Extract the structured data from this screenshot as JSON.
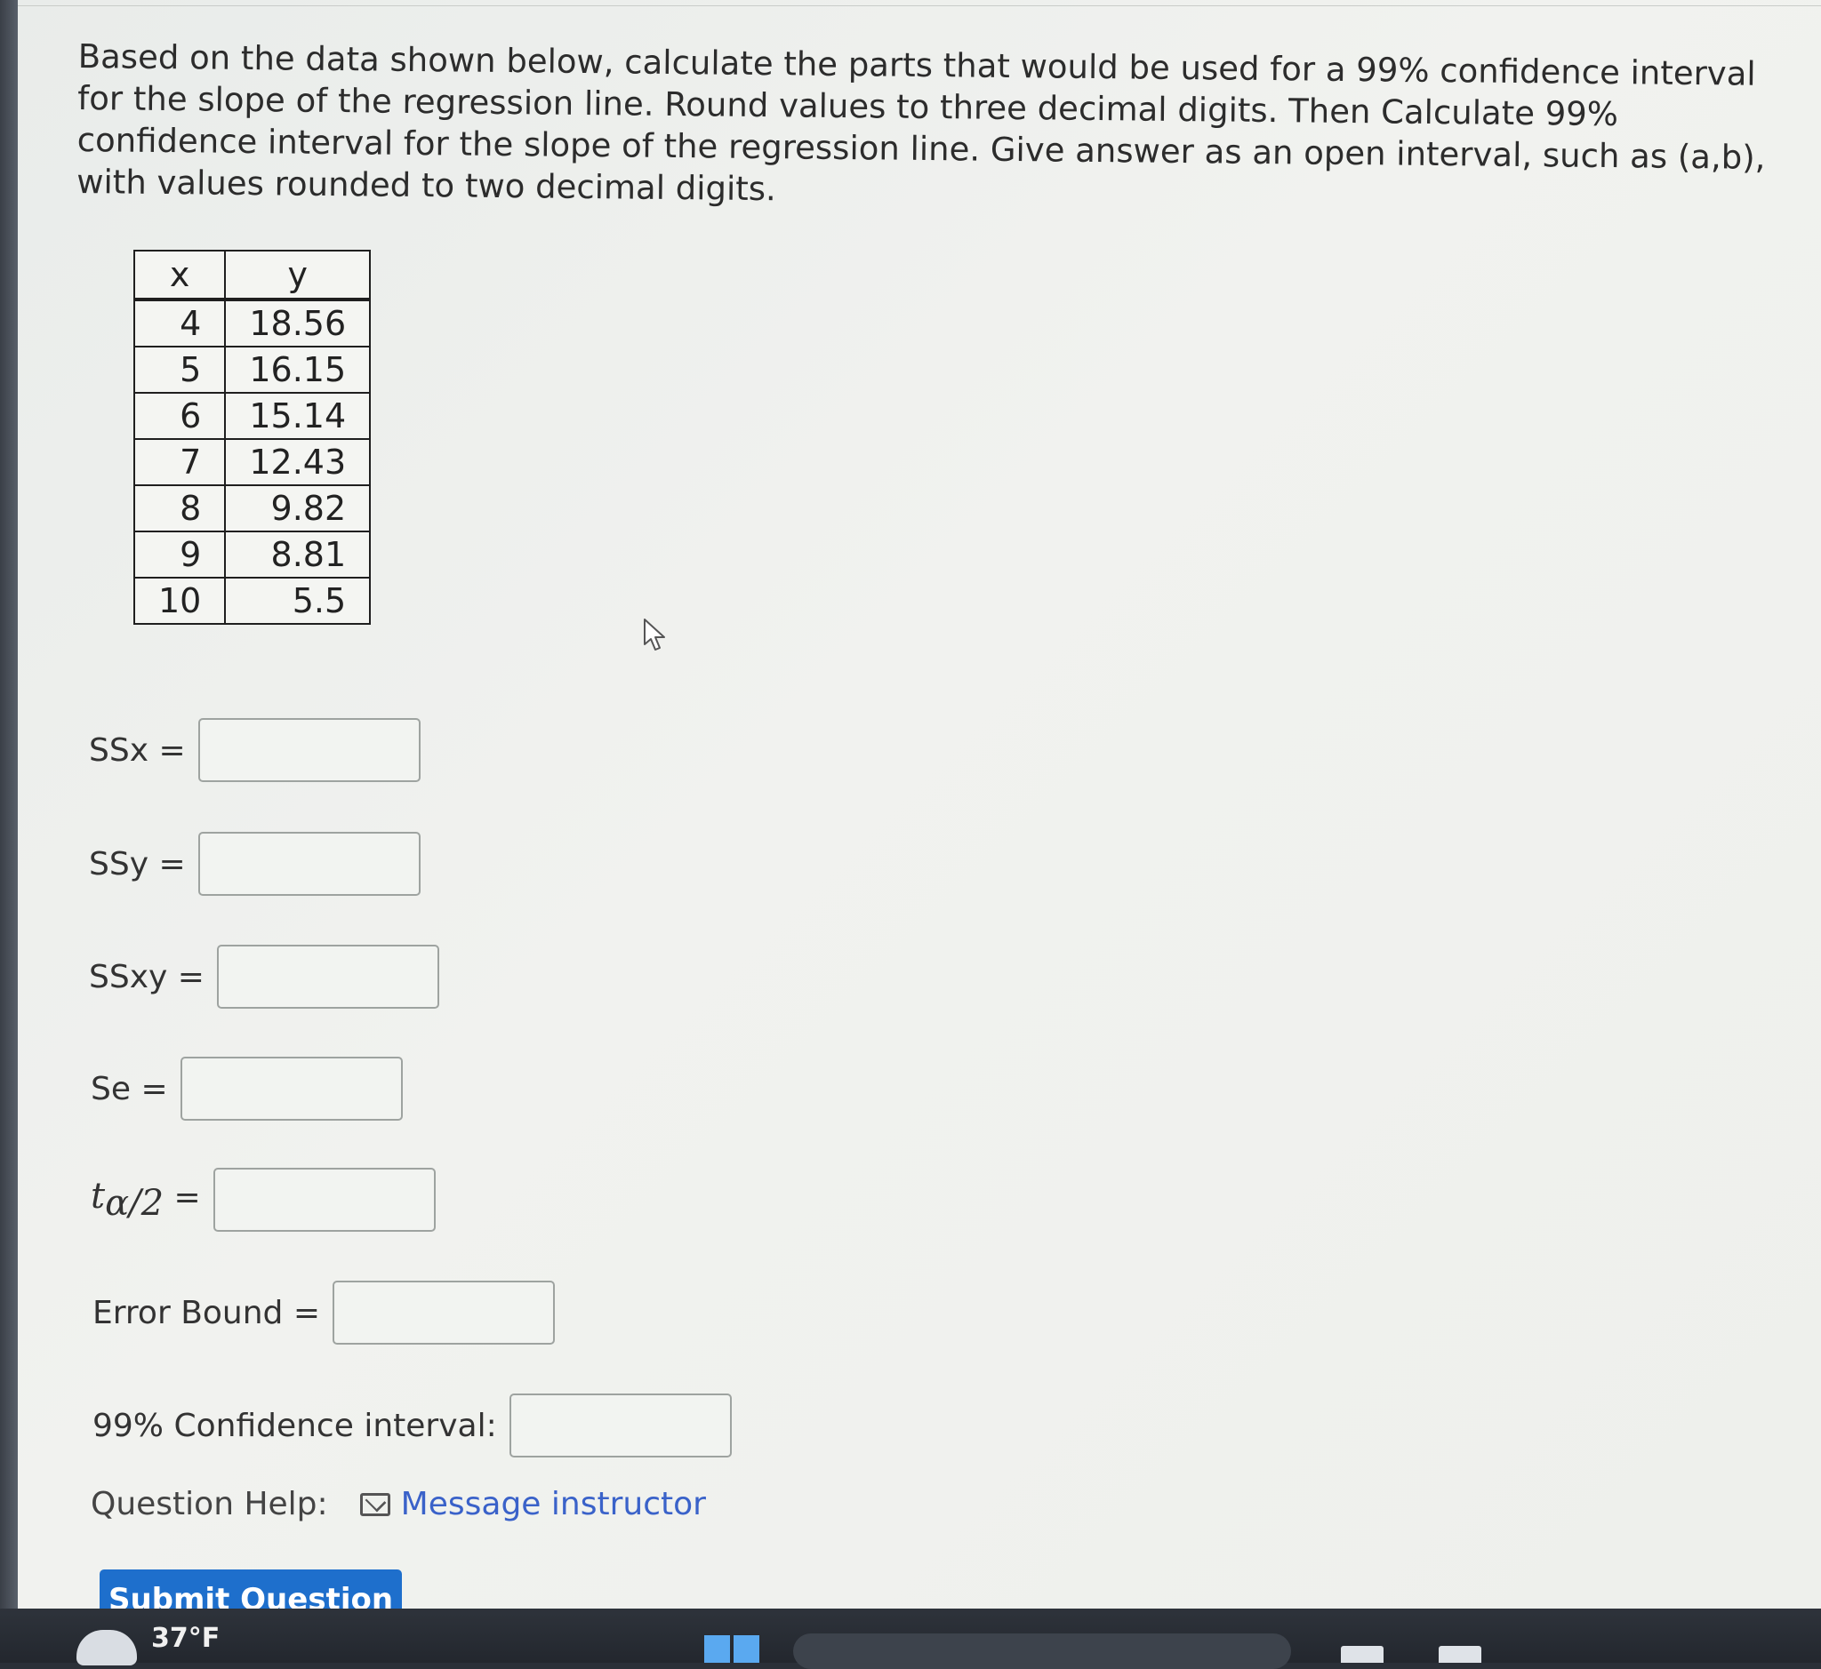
{
  "question": {
    "text": "Based on the data shown below, calculate the parts that would be used for a 99% confidence interval for the slope of the regression line. Round values to three decimal digits. Then Calculate 99% confidence interval for the slope of the regression line. Give answer as an open interval, such as (a,b), with values rounded to two decimal digits."
  },
  "table": {
    "headers": [
      "x",
      "y"
    ],
    "rows": [
      [
        "4",
        "18.56"
      ],
      [
        "5",
        "16.15"
      ],
      [
        "6",
        "15.14"
      ],
      [
        "7",
        "12.43"
      ],
      [
        "8",
        "9.82"
      ],
      [
        "9",
        "8.81"
      ],
      [
        "10",
        "5.5"
      ]
    ]
  },
  "fields": {
    "ssx": {
      "label": "SSx =",
      "value": ""
    },
    "ssy": {
      "label": "SSy =",
      "value": ""
    },
    "ssxy": {
      "label": "SSxy =",
      "value": ""
    },
    "se": {
      "label": "Se =",
      "value": ""
    },
    "t_alpha": {
      "t": "t",
      "sub": "α/2",
      "eq": "=",
      "value": ""
    },
    "error_bound": {
      "label": "Error Bound =",
      "value": ""
    },
    "confidence_interval": {
      "label": "99% Confidence interval:",
      "value": ""
    }
  },
  "help": {
    "label": "Question Help:",
    "link": "Message instructor"
  },
  "submit_label": "Submit Question",
  "taskbar": {
    "temperature": "37°F"
  }
}
